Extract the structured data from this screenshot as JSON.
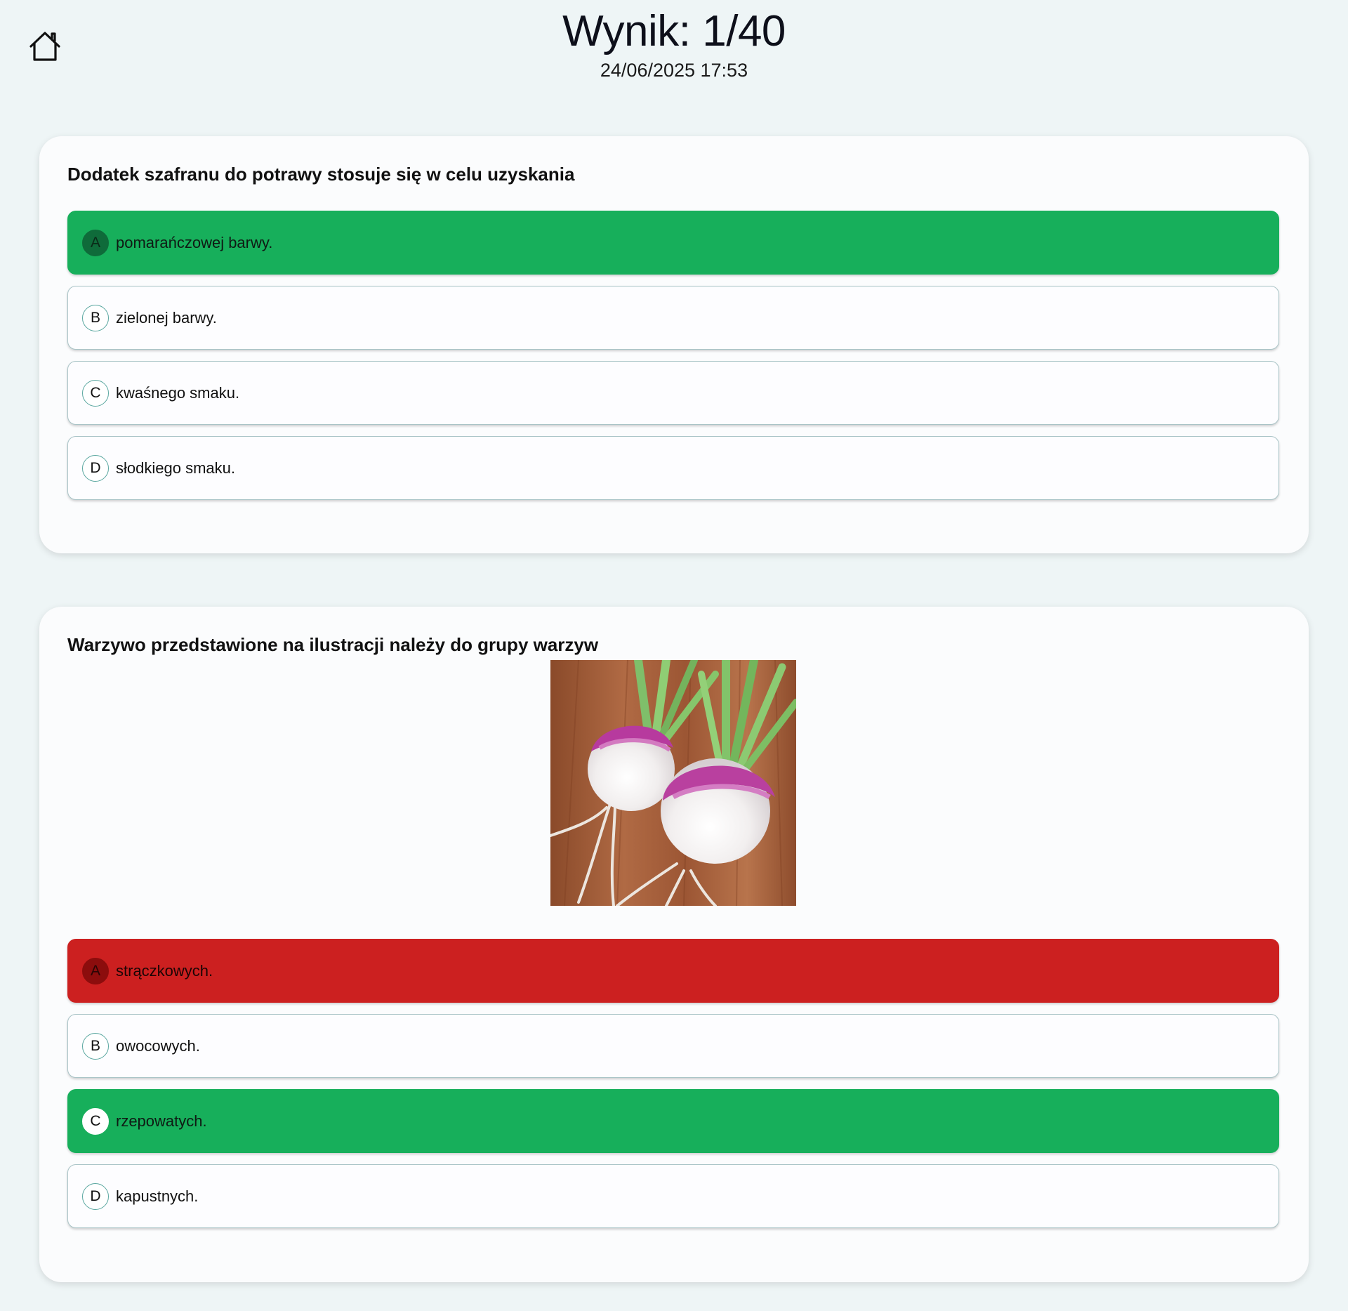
{
  "header": {
    "score": "Wynik: 1/40",
    "date": "24/06/2025 17:53"
  },
  "home": {
    "icon": "home-icon"
  },
  "colors": {
    "correct": "#17af5b",
    "wrong": "#cc2020",
    "background": "#eef5f6"
  },
  "questions": [
    {
      "text": "Dodatek szafranu do potrawy stosuje się w celu uzyskania",
      "answers": [
        {
          "letter": "A",
          "text": "pomarańczowej barwy.",
          "state": "correct"
        },
        {
          "letter": "B",
          "text": "zielonej barwy.",
          "state": "neutral"
        },
        {
          "letter": "C",
          "text": "kwaśnego smaku.",
          "state": "neutral"
        },
        {
          "letter": "D",
          "text": "słodkiego smaku.",
          "state": "neutral"
        }
      ]
    },
    {
      "text": "Warzywo przedstawione na ilustracji należy do grupy warzyw",
      "image": "turnip-photo",
      "answers": [
        {
          "letter": "A",
          "text": "strączkowych.",
          "state": "wrong"
        },
        {
          "letter": "B",
          "text": "owocowych.",
          "state": "neutral"
        },
        {
          "letter": "C",
          "text": "rzepowatych.",
          "state": "correct"
        },
        {
          "letter": "D",
          "text": "kapustnych.",
          "state": "neutral"
        }
      ]
    }
  ]
}
